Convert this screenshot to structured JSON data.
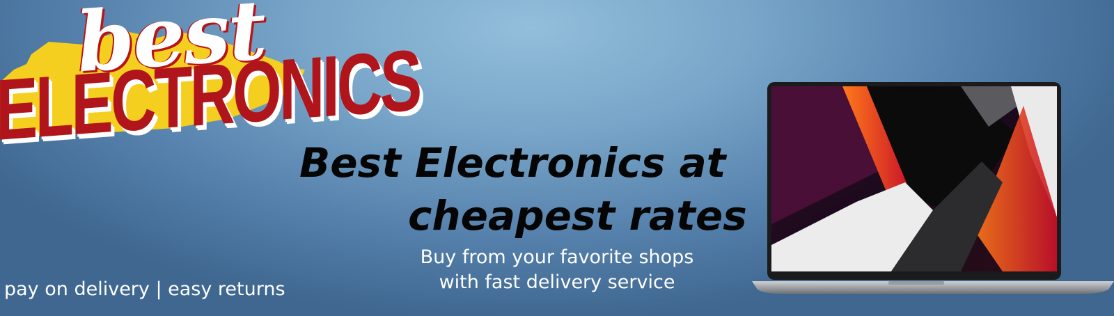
{
  "logo": {
    "script_text": "best",
    "main_text": "ELECTRONICS",
    "icon": "store-logo",
    "colors": {
      "splash": "#f5cf1f",
      "red": "#b0151b",
      "white": "#ffffff"
    }
  },
  "headline": {
    "line1": "Best Electronics at",
    "line2": "cheapest rates"
  },
  "subline": {
    "line1": "Buy from your favorite shops",
    "line2": "with fast delivery service"
  },
  "footer_note": "pay on delivery | easy returns",
  "product_image": {
    "icon": "laptop-icon"
  },
  "colors": {
    "background": "#6a97bd",
    "headline": "#050505",
    "text_light": "#ffffff"
  }
}
